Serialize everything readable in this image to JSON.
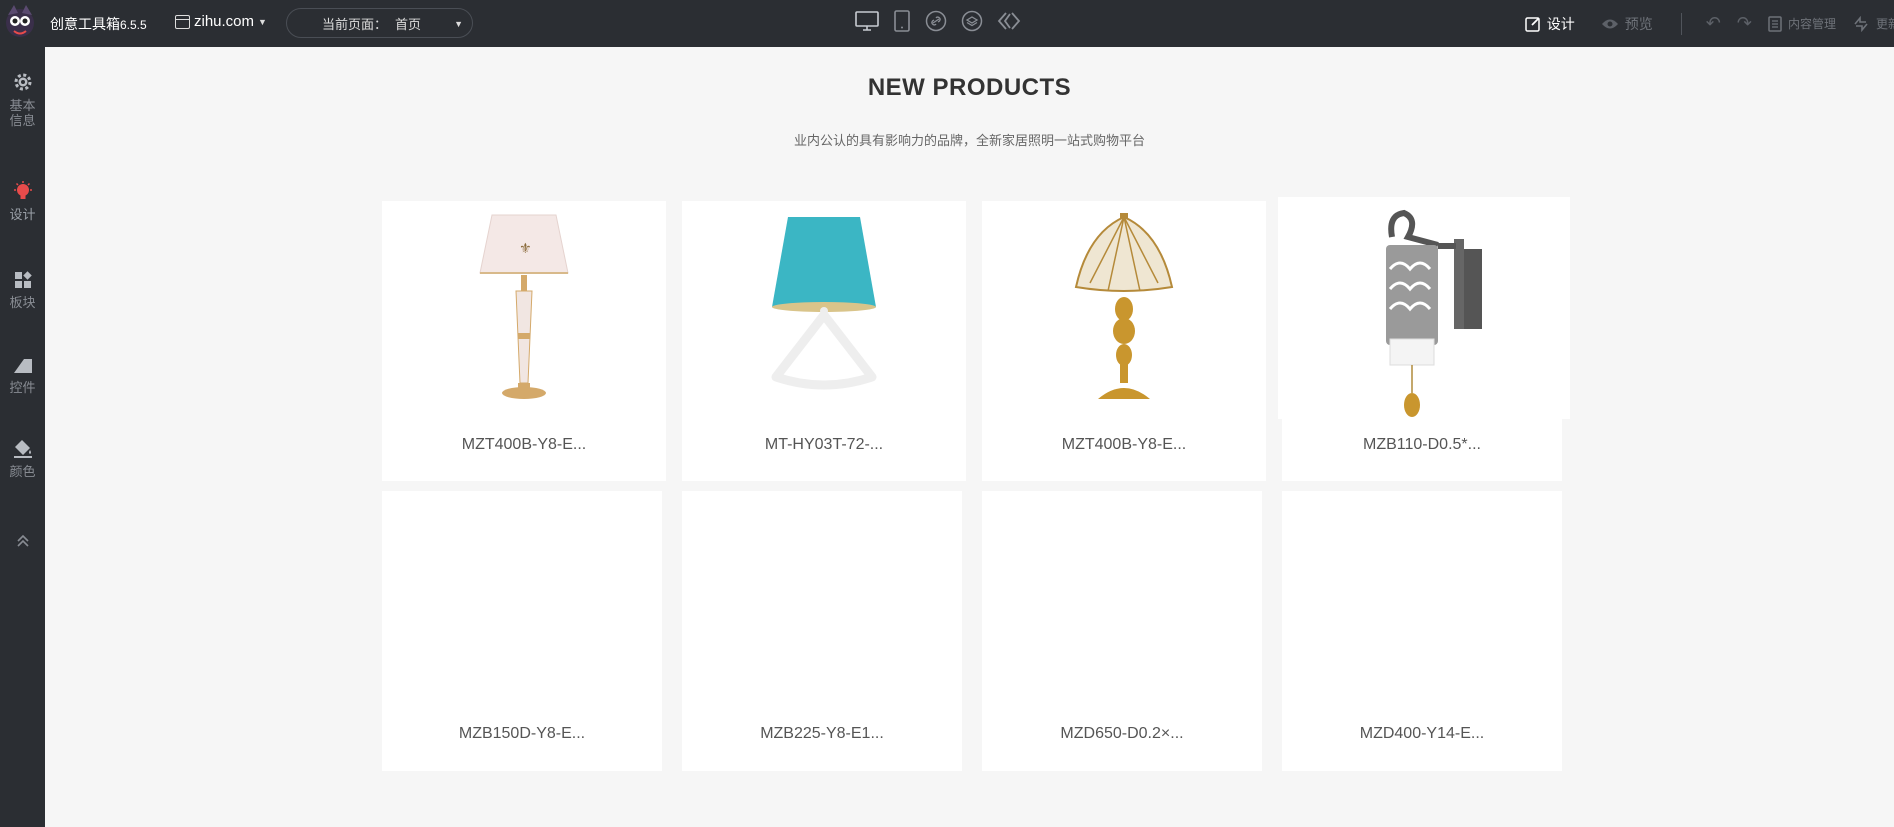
{
  "topbar": {
    "app_name": "创意工具箱",
    "version": "6.5.5",
    "domain": "zihu.com",
    "current_page_label": "当前页面：",
    "current_page_value": "首页",
    "design_label": "设计",
    "preview_label": "预览",
    "content_mgmt_label": "内容管理",
    "update_label": "更新"
  },
  "sidebar": {
    "items": [
      {
        "label": "基本信息",
        "icon": "gear-icon"
      },
      {
        "label": "设计",
        "icon": "bulb-icon"
      },
      {
        "label": "板块",
        "icon": "blocks-icon"
      },
      {
        "label": "控件",
        "icon": "widget-icon"
      },
      {
        "label": "颜色",
        "icon": "paint-bucket-icon"
      }
    ]
  },
  "section": {
    "title": "NEW PRODUCTS",
    "subtitle": "业内公认的具有影响力的品牌，全新家居照明一站式购物平台"
  },
  "products": [
    {
      "name": "MZT400B-Y8-E..."
    },
    {
      "name": "MT-HY03T-72-..."
    },
    {
      "name": "MZT400B-Y8-E..."
    },
    {
      "name": "MZB110-D0.5*..."
    },
    {
      "name": "MZB150D-Y8-E..."
    },
    {
      "name": "MZB225-Y8-E1..."
    },
    {
      "name": "MZD650-D0.2×..."
    },
    {
      "name": "MZD400-Y14-E..."
    }
  ],
  "colors": {
    "topbar_bg": "#2b2e33",
    "canvas_bg": "#f6f6f6",
    "card_bg": "#ffffff",
    "accent_red": "#e84b4b"
  }
}
